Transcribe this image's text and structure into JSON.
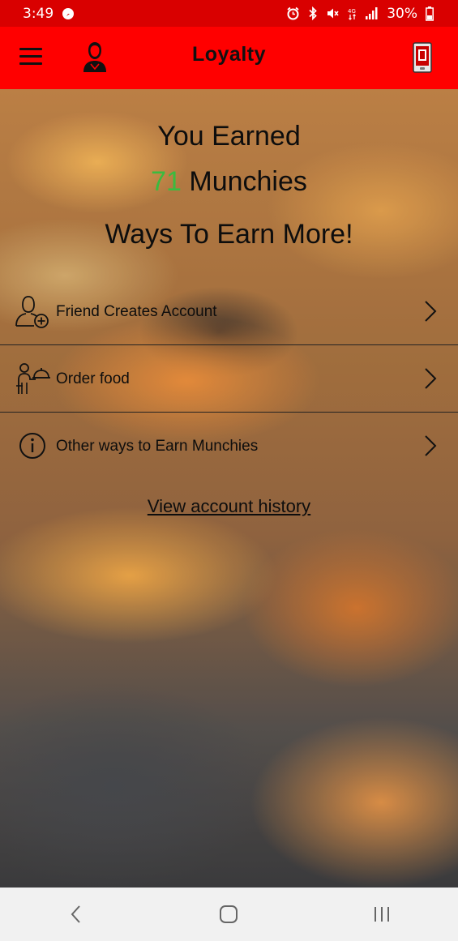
{
  "status_bar": {
    "time": "3:49",
    "battery": "30%"
  },
  "app_bar": {
    "title": "Loyalty"
  },
  "earned": {
    "line1": "You Earned",
    "points": "71",
    "unit": "Munchies"
  },
  "ways_heading": "Ways To Earn More!",
  "ways": [
    {
      "label": "Friend Creates Account",
      "icon": "add-user-icon"
    },
    {
      "label": "Order food",
      "icon": "waiter-icon"
    },
    {
      "label": "Other ways to Earn Munchies",
      "icon": "info-icon"
    }
  ],
  "history_link": "View account history",
  "colors": {
    "app_bar": "#ff0000",
    "status_bar": "#d90000",
    "points": "#3bbb3f"
  }
}
